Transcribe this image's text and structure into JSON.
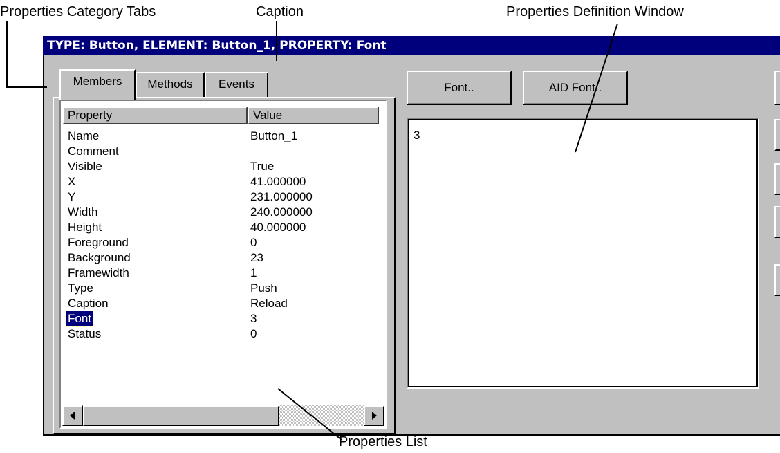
{
  "callouts": {
    "tabs_label": "Properties Category Tabs",
    "caption_label": "Caption",
    "definition_label": "Properties Definition Window",
    "list_label": "Properties List"
  },
  "window": {
    "title": "TYPE: Button,  ELEMENT: Button_1,  PROPERTY: Font"
  },
  "tabs": [
    {
      "label": "Members",
      "active": true
    },
    {
      "label": "Methods",
      "active": false
    },
    {
      "label": "Events",
      "active": false
    }
  ],
  "properties_list": {
    "columns": [
      "Property",
      "Value"
    ],
    "rows": [
      {
        "name": "Name",
        "value": "Button_1"
      },
      {
        "name": "Comment",
        "value": ""
      },
      {
        "name": "Visible",
        "value": "True"
      },
      {
        "name": "X",
        "value": "41.000000"
      },
      {
        "name": "Y",
        "value": "231.000000"
      },
      {
        "name": "Width",
        "value": "240.000000"
      },
      {
        "name": "Height",
        "value": "40.000000"
      },
      {
        "name": "Foreground",
        "value": "0"
      },
      {
        "name": "Background",
        "value": "23"
      },
      {
        "name": "Framewidth",
        "value": "1"
      },
      {
        "name": "Type",
        "value": "Push"
      },
      {
        "name": "Caption",
        "value": "Reload"
      },
      {
        "name": "Font",
        "value": "3",
        "selected": true
      },
      {
        "name": "Status",
        "value": "0"
      }
    ],
    "scroll_left_icon": "arrow-left-icon",
    "scroll_right_icon": "arrow-right-icon"
  },
  "toolbar": {
    "font_button": "Font..",
    "aid_font_button": "AID Font.."
  },
  "definition": {
    "value": "3"
  },
  "colors": {
    "titlebar": "#00007c",
    "face": "#c0c0c0",
    "selection": "#00007c"
  }
}
